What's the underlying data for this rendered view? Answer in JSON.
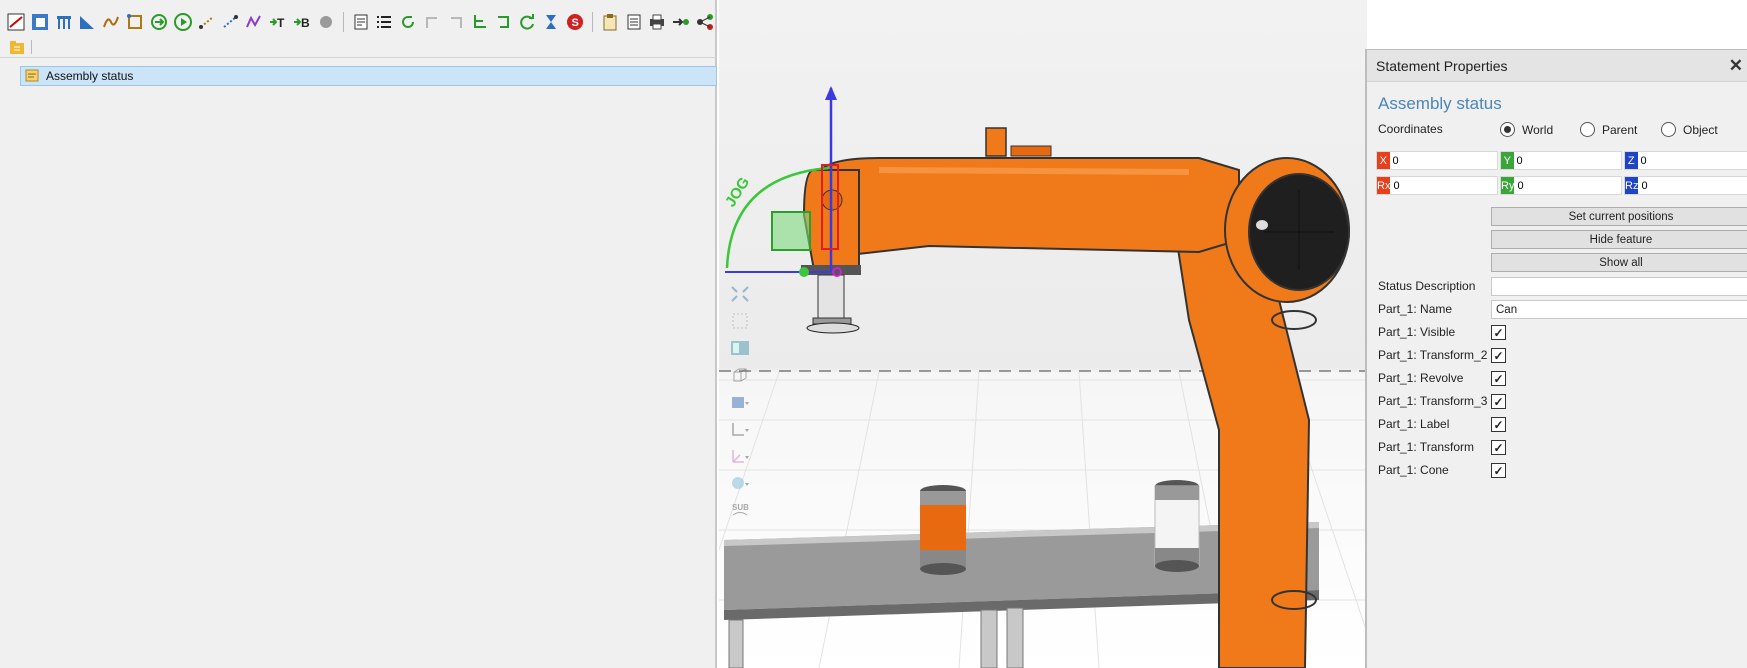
{
  "toolbar": {
    "row1_icons": [
      "program-icon",
      "subprogram-icon",
      "pallet-icon",
      "measure-icon",
      "path-icon",
      "frame-icon",
      "call-icon",
      "run-icon",
      "line-motion-icon",
      "joint-motion-icon",
      "curve-motion-icon",
      "text-motion-icon",
      "break-icon",
      "stop-icon",
      "statement-icon",
      "list-icon",
      "loop-icon",
      "disabled-icon-1",
      "disabled-icon-2",
      "branch-icon",
      "return-icon",
      "refresh-icon",
      "hourglass-icon",
      "signal-icon",
      "clipboard-icon",
      "document-icon",
      "print-icon",
      "connect-icon",
      "network-icon"
    ],
    "t_label": "T",
    "b_label": "B",
    "signal_letter": "S"
  },
  "tree": {
    "item_label": "Assembly status"
  },
  "viewport": {
    "jog_label": "JOG",
    "sub_label": "SUB"
  },
  "panel": {
    "title": "Statement Properties",
    "close_symbol": "✕",
    "statement_name": "Assembly status",
    "coordinates_label": "Coordinates",
    "radio_world": "World",
    "radio_parent": "Parent",
    "radio_object": "Object",
    "selected_frame": "World",
    "coords": [
      {
        "tag": "X",
        "value": "0",
        "color": "#e8401c"
      },
      {
        "tag": "Y",
        "value": "0",
        "color": "#3aa63a"
      },
      {
        "tag": "Z",
        "value": "0",
        "color": "#2044c8"
      },
      {
        "tag": "Rx",
        "value": "0",
        "color": "#e8401c"
      },
      {
        "tag": "Ry",
        "value": "0",
        "color": "#3aa63a"
      },
      {
        "tag": "Rz",
        "value": "0",
        "color": "#2044c8"
      }
    ],
    "btn_set_current": "Set current positions",
    "btn_hide_feature": "Hide feature",
    "btn_show_all": "Show all",
    "status_description_label": "Status Description",
    "status_description_value": "",
    "part_name_label": "Part_1: Name",
    "part_name_value": "Can",
    "checks": [
      {
        "label": "Part_1: Visible",
        "checked": true
      },
      {
        "label": "Part_1: Transform_2",
        "checked": true
      },
      {
        "label": "Part_1: Revolve",
        "checked": true
      },
      {
        "label": "Part_1: Transform_3",
        "checked": true
      },
      {
        "label": "Part_1: Label",
        "checked": true
      },
      {
        "label": "Part_1: Transform",
        "checked": true
      },
      {
        "label": "Part_1: Cone",
        "checked": true
      }
    ],
    "check_mark": "✓"
  },
  "colors": {
    "robot_orange": "#f07a1a",
    "accent_blue": "#4a86b8",
    "selection_blue": "#cce4f7"
  }
}
